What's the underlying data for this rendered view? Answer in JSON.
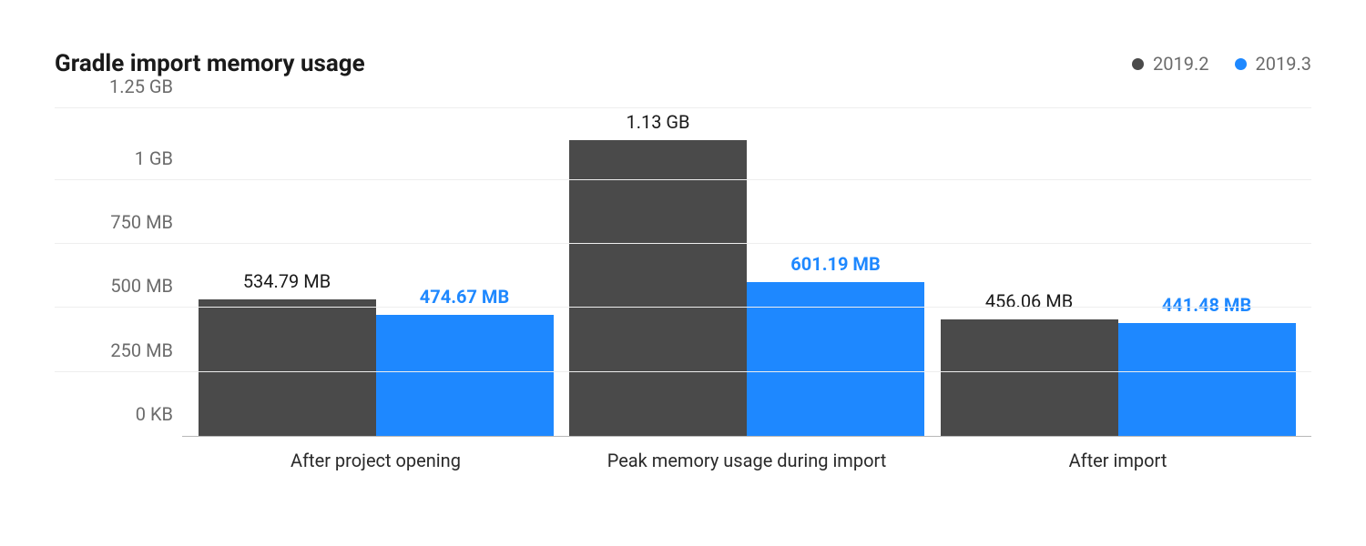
{
  "title": "Gradle import memory usage",
  "legend": [
    {
      "name": "2019.2",
      "color": "#4a4a4a"
    },
    {
      "name": "2019.3",
      "color": "#1E88FF"
    }
  ],
  "chart_data": {
    "type": "bar",
    "title": "Gradle import memory usage",
    "xlabel": "",
    "ylabel": "",
    "categories": [
      "After project opening",
      "Peak memory usage during import",
      "After import"
    ],
    "series": [
      {
        "name": "2019.2",
        "values_mb": [
          534.79,
          1157.12,
          456.06
        ],
        "value_labels": [
          "534.79 MB",
          "1.13 GB",
          "456.06 MB"
        ],
        "color": "#4a4a4a"
      },
      {
        "name": "2019.3",
        "values_mb": [
          474.67,
          601.19,
          441.48
        ],
        "value_labels": [
          "474.67 MB",
          "601.19 MB",
          "441.48 MB"
        ],
        "color": "#1E88FF"
      }
    ],
    "ylim_mb": [
      0,
      1280
    ],
    "yticks_mb": [
      0,
      250,
      500,
      750,
      1000,
      1280
    ],
    "ytick_labels": [
      "0 KB",
      "250 MB",
      "500 MB",
      "750 MB",
      "1 GB",
      "1.25 GB"
    ]
  }
}
